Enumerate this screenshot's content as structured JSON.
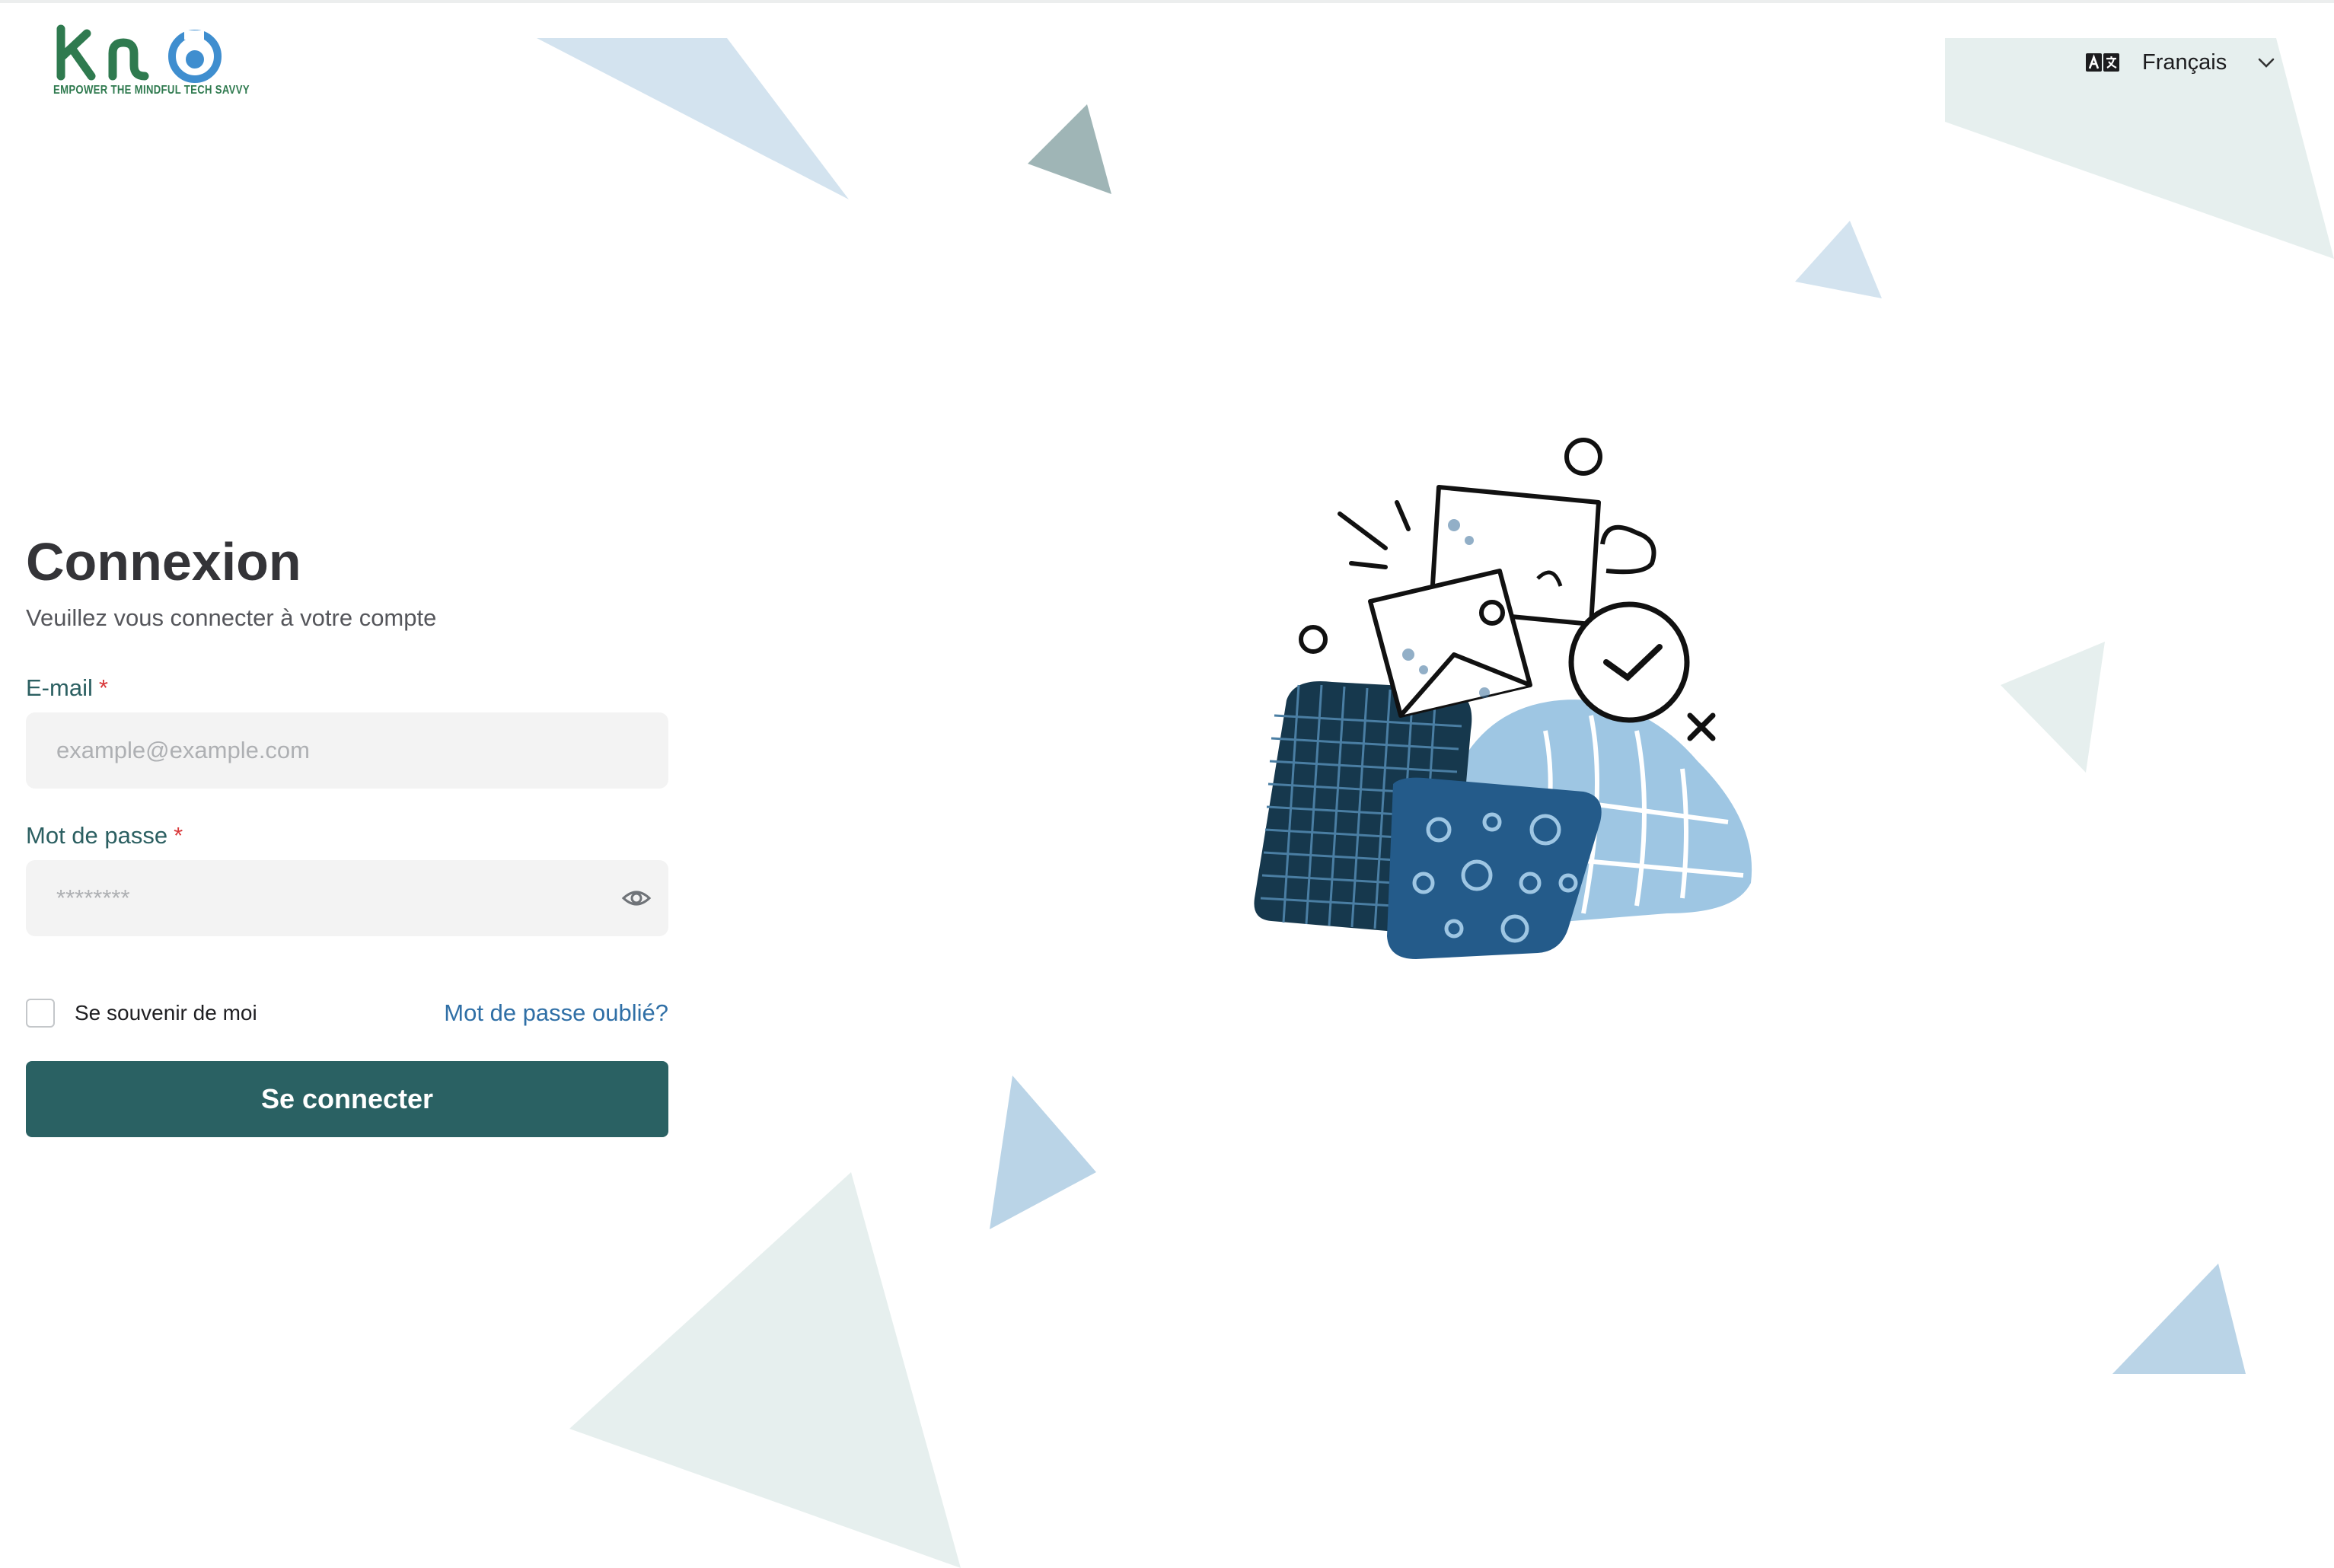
{
  "header": {
    "logo_tagline": "EMPOWER THE MINDFUL TECH SAVVY",
    "language": {
      "selected": "Français",
      "icon": "translate-icon"
    }
  },
  "form": {
    "title": "Connexion",
    "subtitle": "Veuillez vous connecter à votre compte",
    "email": {
      "label": "E-mail",
      "required_mark": "*",
      "placeholder": "example@example.com",
      "value": ""
    },
    "password": {
      "label": "Mot de passe",
      "required_mark": "*",
      "placeholder": "********",
      "value": "",
      "toggle_icon": "eye-icon"
    },
    "remember_me": {
      "label": "Se souvenir de moi",
      "checked": false
    },
    "forgot_password": "Mot de passe oublié?",
    "submit_label": "Se connecter"
  },
  "colors": {
    "primary": "#2a6163",
    "label": "#2b5f61",
    "link": "#2f6fa6",
    "required": "#d9383a",
    "input_bg": "#f3f3f3"
  }
}
